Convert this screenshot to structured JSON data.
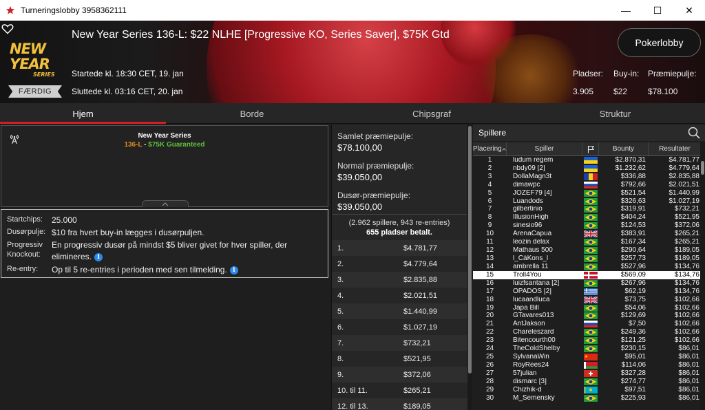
{
  "window": {
    "title": "Turneringslobby 3958362111",
    "minimize": "—",
    "maximize": "☐",
    "close": "✕"
  },
  "header": {
    "logo_line1": "NEW YEAR",
    "logo_line2": "SERIES",
    "status": "FÆRDIG",
    "tournament_name": "New Year Series 136-L: $22 NLHE [Progressive KO, Series Saver], $75K Gtd",
    "started": "Startede kl. 18:30 CET, 19. jan",
    "ended": "Sluttede kl. 03:16 CET, 20. jan",
    "pokerlobby_button": "Pokerlobby",
    "stats": [
      {
        "label": "Pladser:",
        "value": "3.905"
      },
      {
        "label": "Buy-in:",
        "value": "$22"
      },
      {
        "label": "Præmiepulje:",
        "value": "$78.100"
      }
    ]
  },
  "tabs": [
    "Hjem",
    "Borde",
    "Chipsgraf",
    "Struktur"
  ],
  "series_box": {
    "title": "New Year Series",
    "code": "136-L",
    "separator": " - ",
    "guarantee": "$75K Guaranteed"
  },
  "info": {
    "startchips_label": "Startchips:",
    "startchips_value": "25.000",
    "bounty_label": "Dusørpulje:",
    "bounty_value": "$10 fra hvert buy-in lægges i dusørpuljen.",
    "progressive_label1": "Progressiv",
    "progressive_label2": "Knockout:",
    "progressive_value1": "En progressiv dusør på mindst $5 bliver givet for hver spiller, der",
    "progressive_value2": "elimineres.",
    "reentry_label": "Re-entry:",
    "reentry_value": "Op til 5 re-entries i perioden med sen tilmelding."
  },
  "prize": {
    "total_label": "Samlet præmiepulje:",
    "total_value": "$78.100,00",
    "normal_label": "Normal præmiepulje:",
    "normal_value": "$39.050,00",
    "bounty_label": "Dusør-præmiepulje:",
    "bounty_value": "$39.050,00",
    "players_text": "(2.962 spillere, 943 re-entries)",
    "paid_text": "655 pladser betalt.",
    "payouts": [
      {
        "place": "1.",
        "amount": "$4.781,77"
      },
      {
        "place": "2.",
        "amount": "$4.779,64"
      },
      {
        "place": "3.",
        "amount": "$2.835,88"
      },
      {
        "place": "4.",
        "amount": "$2.021,51"
      },
      {
        "place": "5.",
        "amount": "$1.440,99"
      },
      {
        "place": "6.",
        "amount": "$1.027,19"
      },
      {
        "place": "7.",
        "amount": "$732,21"
      },
      {
        "place": "8.",
        "amount": "$521,95"
      },
      {
        "place": "9.",
        "amount": "$372,06"
      },
      {
        "place": "10. til 11.",
        "amount": "$265,21"
      },
      {
        "place": "12. til 13.",
        "amount": "$189,05"
      }
    ]
  },
  "players": {
    "title": "Spillere",
    "columns": [
      "Placering",
      "Spiller",
      "",
      "Bounty",
      "Resultater"
    ],
    "rows": [
      {
        "pos": "1",
        "name": "ludum regem",
        "flag": "UA",
        "bounty": "$2.870,31",
        "result": "$4.781,77"
      },
      {
        "pos": "2",
        "name": "nbdy09 [2]",
        "flag": "UA",
        "bounty": "$1.232,62",
        "result": "$4.779,64"
      },
      {
        "pos": "3",
        "name": "DollaMagn3t",
        "flag": "RO",
        "bounty": "$336,88",
        "result": "$2.835,88"
      },
      {
        "pos": "4",
        "name": "dimawpc",
        "flag": "RU",
        "bounty": "$792,66",
        "result": "$2.021,51"
      },
      {
        "pos": "5",
        "name": "JOZEF79 [4]",
        "flag": "BR",
        "bounty": "$521,54",
        "result": "$1.440,99"
      },
      {
        "pos": "6",
        "name": "Luandods",
        "flag": "BR",
        "bounty": "$326,63",
        "result": "$1.027,19"
      },
      {
        "pos": "7",
        "name": "gilbertinio",
        "flag": "BR",
        "bounty": "$319,91",
        "result": "$732,21"
      },
      {
        "pos": "8",
        "name": "IllusionHigh",
        "flag": "BR",
        "bounty": "$404,24",
        "result": "$521,95"
      },
      {
        "pos": "9",
        "name": "sinesio96",
        "flag": "BR",
        "bounty": "$124,53",
        "result": "$372,06"
      },
      {
        "pos": "10",
        "name": "ArenaCapua",
        "flag": "GB",
        "bounty": "$383,91",
        "result": "$265,21"
      },
      {
        "pos": "11",
        "name": "leozin delax",
        "flag": "BR",
        "bounty": "$167,34",
        "result": "$265,21"
      },
      {
        "pos": "12",
        "name": "Mathaus 500",
        "flag": "BR",
        "bounty": "$290,64",
        "result": "$189,05"
      },
      {
        "pos": "13",
        "name": "l_CàKons_l",
        "flag": "BR",
        "bounty": "$257,73",
        "result": "$189,05"
      },
      {
        "pos": "14",
        "name": "ambrella 11",
        "flag": "BR",
        "bounty": "$527,96",
        "result": "$134,76"
      },
      {
        "pos": "15",
        "name": "Troll4You",
        "flag": "DK",
        "bounty": "$569,09",
        "result": "$134,76",
        "highlight": true
      },
      {
        "pos": "16",
        "name": "luizfsantana [2]",
        "flag": "BR",
        "bounty": "$267,96",
        "result": "$134,76"
      },
      {
        "pos": "17",
        "name": "OPADOS [2]",
        "flag": "GR",
        "bounty": "$62,19",
        "result": "$134,76"
      },
      {
        "pos": "18",
        "name": "lucaandluca",
        "flag": "GB",
        "bounty": "$73,75",
        "result": "$102,66"
      },
      {
        "pos": "19",
        "name": "Japa Bill",
        "flag": "BR",
        "bounty": "$54,06",
        "result": "$102,66"
      },
      {
        "pos": "20",
        "name": "GTavares013",
        "flag": "BR",
        "bounty": "$129,69",
        "result": "$102,66"
      },
      {
        "pos": "21",
        "name": "AntJakson",
        "flag": "RU",
        "bounty": "$7,50",
        "result": "$102,66"
      },
      {
        "pos": "22",
        "name": "Chareleszard",
        "flag": "BR",
        "bounty": "$249,36",
        "result": "$102,66"
      },
      {
        "pos": "23",
        "name": "Bitencourth00",
        "flag": "BR",
        "bounty": "$121,25",
        "result": "$102,66"
      },
      {
        "pos": "24",
        "name": "TheColdShelby",
        "flag": "BR",
        "bounty": "$230,15",
        "result": "$86,01"
      },
      {
        "pos": "25",
        "name": "SylvanaWin",
        "flag": "CN",
        "bounty": "$95,01",
        "result": "$86,01"
      },
      {
        "pos": "26",
        "name": "RoyRees24",
        "flag": "BY",
        "bounty": "$114,06",
        "result": "$86,01"
      },
      {
        "pos": "27",
        "name": "57julian",
        "flag": "CH",
        "bounty": "$327,28",
        "result": "$86,01"
      },
      {
        "pos": "28",
        "name": "dismarc [3]",
        "flag": "BR",
        "bounty": "$274,77",
        "result": "$86,01"
      },
      {
        "pos": "29",
        "name": "Chizhik-d",
        "flag": "KZ",
        "bounty": "$97,51",
        "result": "$86,01"
      },
      {
        "pos": "30",
        "name": "M_Semensky",
        "flag": "BR",
        "bounty": "$225,93",
        "result": "$86,01"
      }
    ]
  },
  "colors": {
    "accent": "#d21f2a",
    "code_orange": "#e0891c",
    "guarantee_green": "#5fbf3a",
    "info_blue": "#2d8ae8"
  }
}
